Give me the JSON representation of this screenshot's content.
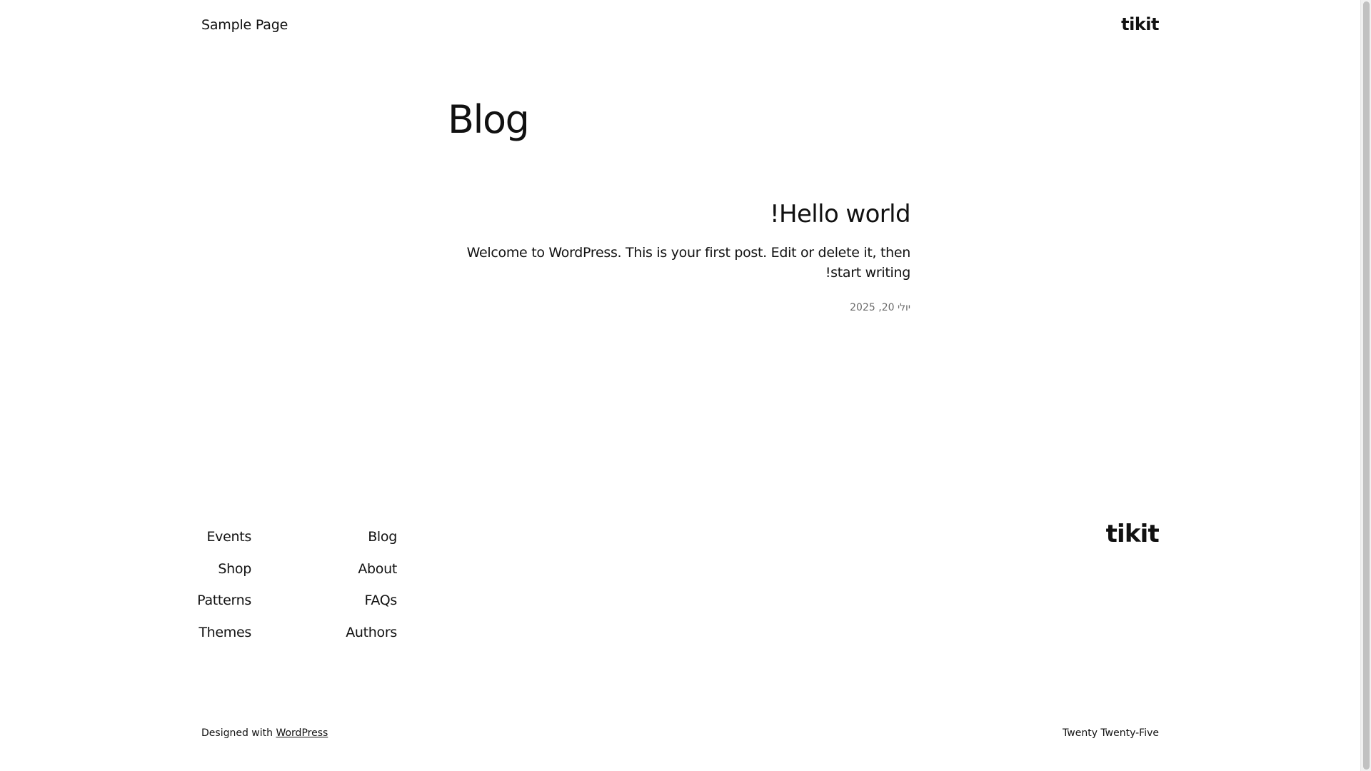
{
  "header": {
    "nav_link": "Sample Page",
    "site_title": "tikit"
  },
  "main": {
    "heading": "Blog",
    "post": {
      "title": "Hello world!",
      "excerpt": "Welcome to WordPress. This is your first post. Edit or delete it, then start writing!",
      "date": "יולי 20, 2025"
    }
  },
  "footer": {
    "column_1": [
      "Events",
      "Shop",
      "Patterns",
      "Themes"
    ],
    "column_2": [
      "Blog",
      "About",
      "FAQs",
      "Authors"
    ],
    "site_title": "tikit",
    "credit_prefix": "Designed with",
    "credit_link": "WordPress",
    "theme_name": "Twenty Twenty-Five"
  }
}
